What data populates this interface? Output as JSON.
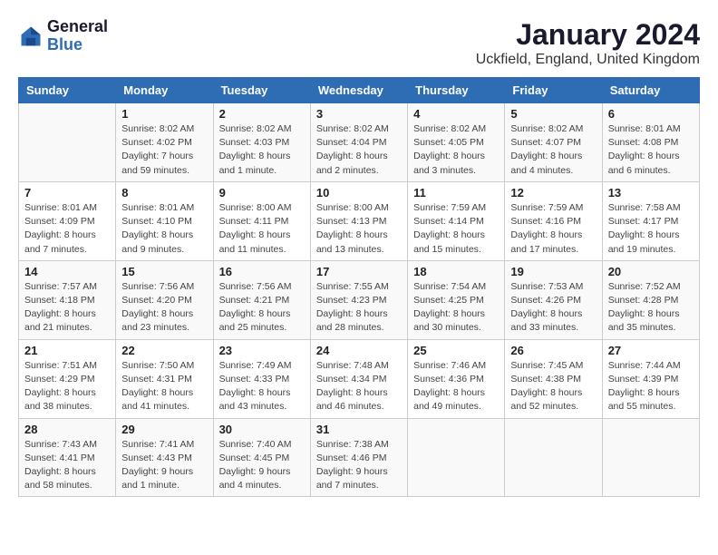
{
  "header": {
    "logo_line1": "General",
    "logo_line2": "Blue",
    "month_year": "January 2024",
    "location": "Uckfield, England, United Kingdom"
  },
  "days_of_week": [
    "Sunday",
    "Monday",
    "Tuesday",
    "Wednesday",
    "Thursday",
    "Friday",
    "Saturday"
  ],
  "weeks": [
    [
      {
        "day": "",
        "detail": ""
      },
      {
        "day": "1",
        "detail": "Sunrise: 8:02 AM\nSunset: 4:02 PM\nDaylight: 7 hours\nand 59 minutes."
      },
      {
        "day": "2",
        "detail": "Sunrise: 8:02 AM\nSunset: 4:03 PM\nDaylight: 8 hours\nand 1 minute."
      },
      {
        "day": "3",
        "detail": "Sunrise: 8:02 AM\nSunset: 4:04 PM\nDaylight: 8 hours\nand 2 minutes."
      },
      {
        "day": "4",
        "detail": "Sunrise: 8:02 AM\nSunset: 4:05 PM\nDaylight: 8 hours\nand 3 minutes."
      },
      {
        "day": "5",
        "detail": "Sunrise: 8:02 AM\nSunset: 4:07 PM\nDaylight: 8 hours\nand 4 minutes."
      },
      {
        "day": "6",
        "detail": "Sunrise: 8:01 AM\nSunset: 4:08 PM\nDaylight: 8 hours\nand 6 minutes."
      }
    ],
    [
      {
        "day": "7",
        "detail": "Sunrise: 8:01 AM\nSunset: 4:09 PM\nDaylight: 8 hours\nand 7 minutes."
      },
      {
        "day": "8",
        "detail": "Sunrise: 8:01 AM\nSunset: 4:10 PM\nDaylight: 8 hours\nand 9 minutes."
      },
      {
        "day": "9",
        "detail": "Sunrise: 8:00 AM\nSunset: 4:11 PM\nDaylight: 8 hours\nand 11 minutes."
      },
      {
        "day": "10",
        "detail": "Sunrise: 8:00 AM\nSunset: 4:13 PM\nDaylight: 8 hours\nand 13 minutes."
      },
      {
        "day": "11",
        "detail": "Sunrise: 7:59 AM\nSunset: 4:14 PM\nDaylight: 8 hours\nand 15 minutes."
      },
      {
        "day": "12",
        "detail": "Sunrise: 7:59 AM\nSunset: 4:16 PM\nDaylight: 8 hours\nand 17 minutes."
      },
      {
        "day": "13",
        "detail": "Sunrise: 7:58 AM\nSunset: 4:17 PM\nDaylight: 8 hours\nand 19 minutes."
      }
    ],
    [
      {
        "day": "14",
        "detail": "Sunrise: 7:57 AM\nSunset: 4:18 PM\nDaylight: 8 hours\nand 21 minutes."
      },
      {
        "day": "15",
        "detail": "Sunrise: 7:56 AM\nSunset: 4:20 PM\nDaylight: 8 hours\nand 23 minutes."
      },
      {
        "day": "16",
        "detail": "Sunrise: 7:56 AM\nSunset: 4:21 PM\nDaylight: 8 hours\nand 25 minutes."
      },
      {
        "day": "17",
        "detail": "Sunrise: 7:55 AM\nSunset: 4:23 PM\nDaylight: 8 hours\nand 28 minutes."
      },
      {
        "day": "18",
        "detail": "Sunrise: 7:54 AM\nSunset: 4:25 PM\nDaylight: 8 hours\nand 30 minutes."
      },
      {
        "day": "19",
        "detail": "Sunrise: 7:53 AM\nSunset: 4:26 PM\nDaylight: 8 hours\nand 33 minutes."
      },
      {
        "day": "20",
        "detail": "Sunrise: 7:52 AM\nSunset: 4:28 PM\nDaylight: 8 hours\nand 35 minutes."
      }
    ],
    [
      {
        "day": "21",
        "detail": "Sunrise: 7:51 AM\nSunset: 4:29 PM\nDaylight: 8 hours\nand 38 minutes."
      },
      {
        "day": "22",
        "detail": "Sunrise: 7:50 AM\nSunset: 4:31 PM\nDaylight: 8 hours\nand 41 minutes."
      },
      {
        "day": "23",
        "detail": "Sunrise: 7:49 AM\nSunset: 4:33 PM\nDaylight: 8 hours\nand 43 minutes."
      },
      {
        "day": "24",
        "detail": "Sunrise: 7:48 AM\nSunset: 4:34 PM\nDaylight: 8 hours\nand 46 minutes."
      },
      {
        "day": "25",
        "detail": "Sunrise: 7:46 AM\nSunset: 4:36 PM\nDaylight: 8 hours\nand 49 minutes."
      },
      {
        "day": "26",
        "detail": "Sunrise: 7:45 AM\nSunset: 4:38 PM\nDaylight: 8 hours\nand 52 minutes."
      },
      {
        "day": "27",
        "detail": "Sunrise: 7:44 AM\nSunset: 4:39 PM\nDaylight: 8 hours\nand 55 minutes."
      }
    ],
    [
      {
        "day": "28",
        "detail": "Sunrise: 7:43 AM\nSunset: 4:41 PM\nDaylight: 8 hours\nand 58 minutes."
      },
      {
        "day": "29",
        "detail": "Sunrise: 7:41 AM\nSunset: 4:43 PM\nDaylight: 9 hours\nand 1 minute."
      },
      {
        "day": "30",
        "detail": "Sunrise: 7:40 AM\nSunset: 4:45 PM\nDaylight: 9 hours\nand 4 minutes."
      },
      {
        "day": "31",
        "detail": "Sunrise: 7:38 AM\nSunset: 4:46 PM\nDaylight: 9 hours\nand 7 minutes."
      },
      {
        "day": "",
        "detail": ""
      },
      {
        "day": "",
        "detail": ""
      },
      {
        "day": "",
        "detail": ""
      }
    ]
  ]
}
